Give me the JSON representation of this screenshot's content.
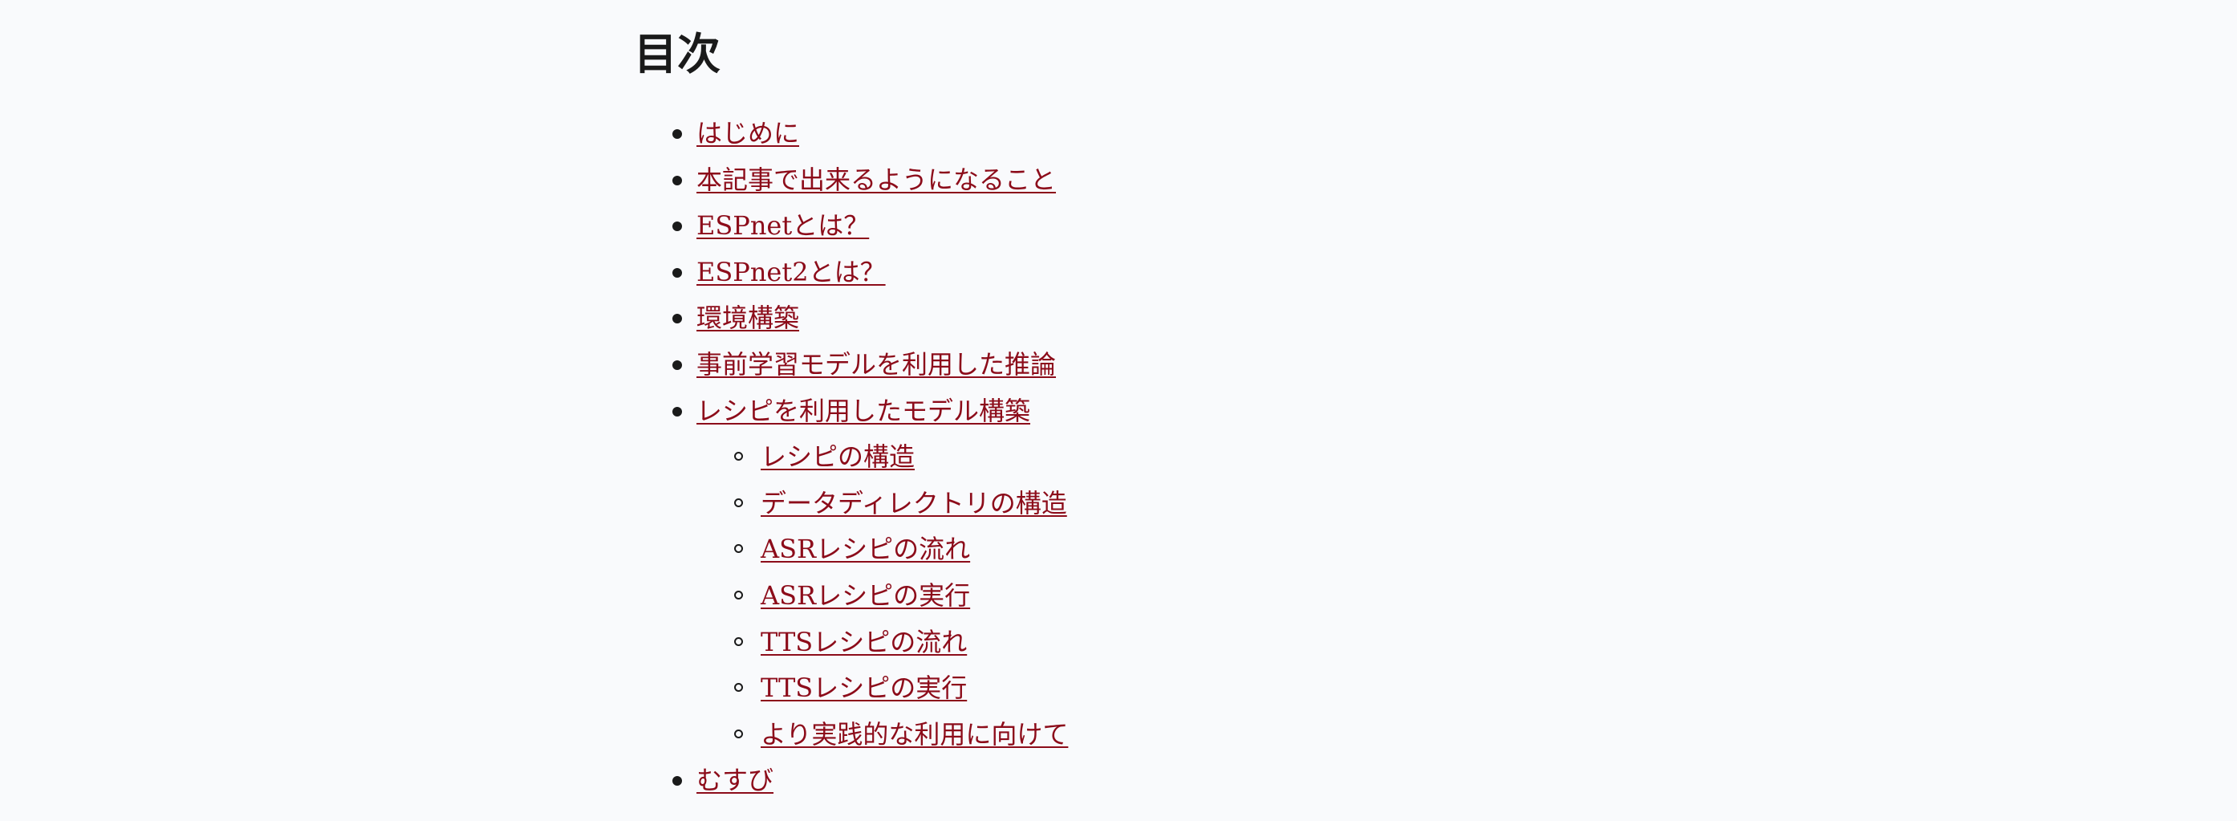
{
  "toc": {
    "title": "目次",
    "items": [
      {
        "label": "はじめに"
      },
      {
        "label": "本記事で出来るようになること"
      },
      {
        "label": "ESPnetとは？"
      },
      {
        "label": "ESPnet2とは？"
      },
      {
        "label": "環境構築"
      },
      {
        "label": "事前学習モデルを利用した推論"
      },
      {
        "label": "レシピを利用したモデル構築",
        "children": [
          {
            "label": "レシピの構造"
          },
          {
            "label": "データディレクトリの構造"
          },
          {
            "label": "ASRレシピの流れ"
          },
          {
            "label": "ASRレシピの実行"
          },
          {
            "label": "TTSレシピの流れ"
          },
          {
            "label": "TTSレシピの実行"
          },
          {
            "label": "より実践的な利用に向けて"
          }
        ]
      },
      {
        "label": "むすび"
      }
    ]
  },
  "colors": {
    "background": "#f9fafc",
    "link": "#8c0c1a",
    "text": "#1a1a1a"
  }
}
